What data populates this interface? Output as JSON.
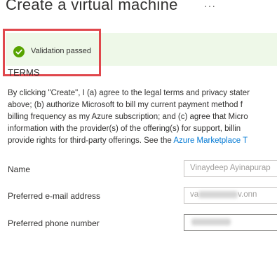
{
  "header": {
    "title": "Create a virtual machine",
    "more_label": "···"
  },
  "banner": {
    "icon": "check-circle-icon",
    "text": "Validation passed",
    "color": "#57a300"
  },
  "terms": {
    "heading": "TERMS",
    "lines": [
      "By clicking \"Create\", I (a) agree to the legal terms and privacy stater",
      "above; (b) authorize Microsoft to bill my current payment method f",
      "billing frequency as my Azure subscription; and (c) agree that Micro",
      "information with the provider(s) of the offering(s) for support, billin"
    ],
    "last_line_prefix": "provide rights for third-party offerings. See the ",
    "link_text": "Azure Marketplace T"
  },
  "form": {
    "name_label": "Name",
    "name_value": "Vinaydeep Ayinapurap",
    "email_label": "Preferred e-mail address",
    "email_prefix": "va",
    "email_suffix": "v.onn",
    "phone_label": "Preferred phone number"
  }
}
